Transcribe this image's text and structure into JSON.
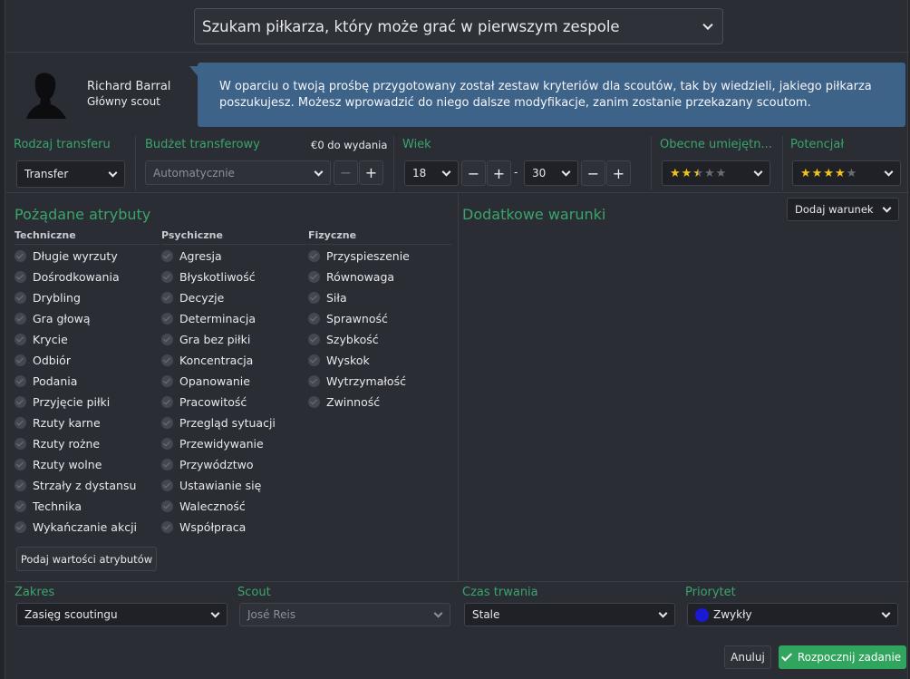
{
  "header": {
    "request": "Szukam piłkarza, który może grać w pierwszym zespole"
  },
  "scout": {
    "name": "Richard Barral",
    "role": "Główny scout",
    "message": "W oparciu o twoją prośbę przygotowany został zestaw kryteriów dla scoutów, tak by wiedzieli, jakiego piłkarza poszukujesz. Możesz wprowadzić do niego dalsze modyfikacje, zanim zostanie przekazany scoutom."
  },
  "criteria": {
    "transfer_type": {
      "label": "Rodzaj transferu",
      "value": "Transfer"
    },
    "budget": {
      "label": "Budżet transferowy",
      "available": "€0 do wydania",
      "value": "Automatycznie",
      "minus": "−",
      "plus": "+"
    },
    "age": {
      "label": "Wiek",
      "min": "18",
      "max": "30",
      "minus": "−",
      "plus": "+",
      "dash": "-"
    },
    "current_ability": {
      "label": "Obecne umiejętn...",
      "stars": 2.5
    },
    "potential": {
      "label": "Potencjał",
      "stars": 4
    }
  },
  "attributes": {
    "title": "Pożądane atrybuty",
    "technical": {
      "header": "Techniczne",
      "items": [
        "Długie wyrzuty",
        "Dośrodkowania",
        "Drybling",
        "Gra głową",
        "Krycie",
        "Odbiór",
        "Podania",
        "Przyjęcie piłki",
        "Rzuty karne",
        "Rzuty rożne",
        "Rzuty wolne",
        "Strzały z dystansu",
        "Technika",
        "Wykańczanie akcji"
      ]
    },
    "mental": {
      "header": "Psychiczne",
      "items": [
        "Agresja",
        "Błyskotliwość",
        "Decyzje",
        "Determinacja",
        "Gra bez piłki",
        "Koncentracja",
        "Opanowanie",
        "Pracowitość",
        "Przegląd sytuacji",
        "Przewidywanie",
        "Przywództwo",
        "Ustawianie się",
        "Waleczność",
        "Współpraca"
      ]
    },
    "physical": {
      "header": "Fizyczne",
      "items": [
        "Przyspieszenie",
        "Równowaga",
        "Siła",
        "Sprawność",
        "Szybkość",
        "Wyskok",
        "Wytrzymałość",
        "Zwinność"
      ]
    },
    "values_button": "Podaj wartości atrybutów"
  },
  "conditions": {
    "title": "Dodatkowe warunki",
    "add_button": "Dodaj warunek"
  },
  "assignment": {
    "range": {
      "label": "Zakres",
      "value": "Zasięg scoutingu"
    },
    "scout": {
      "label": "Scout",
      "value": "José Reis"
    },
    "duration": {
      "label": "Czas trwania",
      "value": "Stale"
    },
    "priority": {
      "label": "Priorytet",
      "value": "Zwykły",
      "color": "#1a1ad6"
    }
  },
  "footer": {
    "cancel": "Anuluj",
    "start": "Rozpocznij zadanie"
  },
  "colors": {
    "accent_green": "#3aa56a",
    "bubble_blue": "#3e6389",
    "star_gold": "#f3c316",
    "start_button": "#2fa55e"
  }
}
